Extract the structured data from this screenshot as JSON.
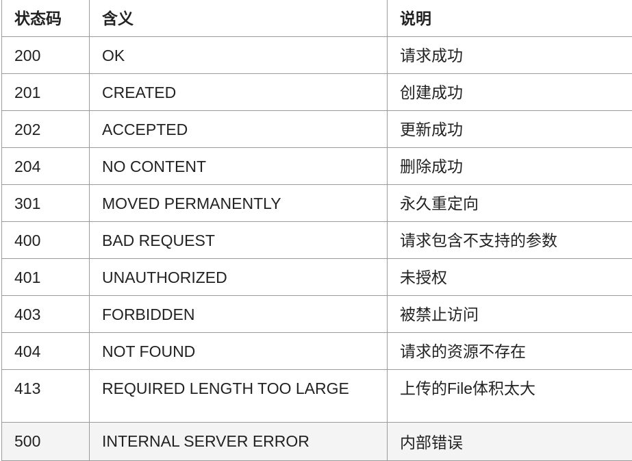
{
  "table": {
    "headers": [
      "状态码",
      "含义",
      "说明"
    ],
    "rows": [
      [
        "200",
        "OK",
        "请求成功"
      ],
      [
        "201",
        "CREATED",
        "创建成功"
      ],
      [
        "202",
        "ACCEPTED",
        "更新成功"
      ],
      [
        "204",
        "NO CONTENT",
        "删除成功"
      ],
      [
        "301",
        "MOVED PERMANENTLY",
        "永久重定向"
      ],
      [
        "400",
        "BAD REQUEST",
        "请求包含不支持的参数"
      ],
      [
        "401",
        "UNAUTHORIZED",
        "未授权"
      ],
      [
        "403",
        "FORBIDDEN",
        "被禁止访问"
      ],
      [
        "404",
        "NOT FOUND",
        "请求的资源不存在"
      ],
      [
        "413",
        "REQUIRED LENGTH TOO LARGE",
        "上传的File体积太大"
      ],
      [
        "500",
        "INTERNAL SERVER ERROR",
        "内部错误"
      ]
    ]
  }
}
